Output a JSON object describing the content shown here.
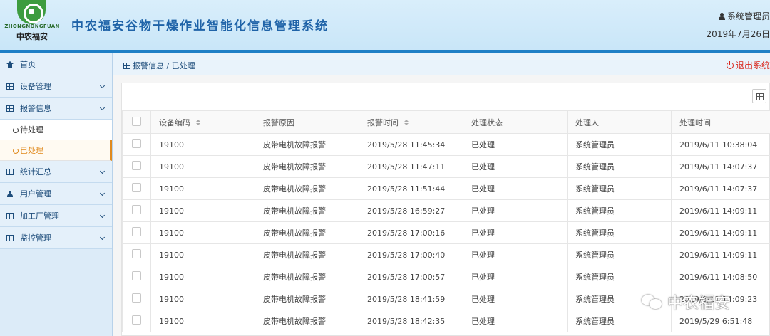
{
  "header": {
    "logo_en": "ZHONGNONGFUAN",
    "logo_cn": "中农福安",
    "title": "中农福安谷物干燥作业智能化信息管理系统",
    "user": "系统管理员",
    "date": "2019年7月26日"
  },
  "sidebar": {
    "items": [
      {
        "label": "首页",
        "icon": "home-icon"
      },
      {
        "label": "设备管理",
        "icon": "grid-icon"
      },
      {
        "label": "报警信息",
        "icon": "grid-icon"
      },
      {
        "label": "统计汇总",
        "icon": "grid-icon"
      },
      {
        "label": "用户管理",
        "icon": "user-icon"
      },
      {
        "label": "加工厂管理",
        "icon": "grid-icon"
      },
      {
        "label": "监控管理",
        "icon": "grid-icon"
      }
    ],
    "alarm_sub": [
      "待处理",
      "已处理"
    ]
  },
  "breadcrumb": {
    "parent": "报警信息",
    "separator": "/",
    "current": "已处理"
  },
  "logout_label": "退出系统",
  "table": {
    "headers": [
      "设备编码",
      "报警原因",
      "报警时间",
      "处理状态",
      "处理人",
      "处理时间"
    ],
    "rows": [
      [
        "19100",
        "皮带电机故障报警",
        "2019/5/28 11:45:34",
        "已处理",
        "系统管理员",
        "2019/6/11 10:38:04"
      ],
      [
        "19100",
        "皮带电机故障报警",
        "2019/5/28 11:47:11",
        "已处理",
        "系统管理员",
        "2019/6/11 14:07:37"
      ],
      [
        "19100",
        "皮带电机故障报警",
        "2019/5/28 11:51:44",
        "已处理",
        "系统管理员",
        "2019/6/11 14:07:37"
      ],
      [
        "19100",
        "皮带电机故障报警",
        "2019/5/28 16:59:27",
        "已处理",
        "系统管理员",
        "2019/6/11 14:09:11"
      ],
      [
        "19100",
        "皮带电机故障报警",
        "2019/5/28 17:00:16",
        "已处理",
        "系统管理员",
        "2019/6/11 14:09:11"
      ],
      [
        "19100",
        "皮带电机故障报警",
        "2019/5/28 17:00:40",
        "已处理",
        "系统管理员",
        "2019/6/11 14:09:11"
      ],
      [
        "19100",
        "皮带电机故障报警",
        "2019/5/28 17:00:57",
        "已处理",
        "系统管理员",
        "2019/6/11 14:08:50"
      ],
      [
        "19100",
        "皮带电机故障报警",
        "2019/5/28 18:41:59",
        "已处理",
        "系统管理员",
        "2019/6/11 14:09:23"
      ],
      [
        "19100",
        "皮带电机故障报警",
        "2019/5/28 18:42:35",
        "已处理",
        "系统管理员",
        "2019/5/29 6:51:48"
      ]
    ]
  },
  "watermark": "中农福安",
  "colors": {
    "primary": "#1e7fc6",
    "active": "#e08a1e",
    "danger": "#d9261c"
  }
}
